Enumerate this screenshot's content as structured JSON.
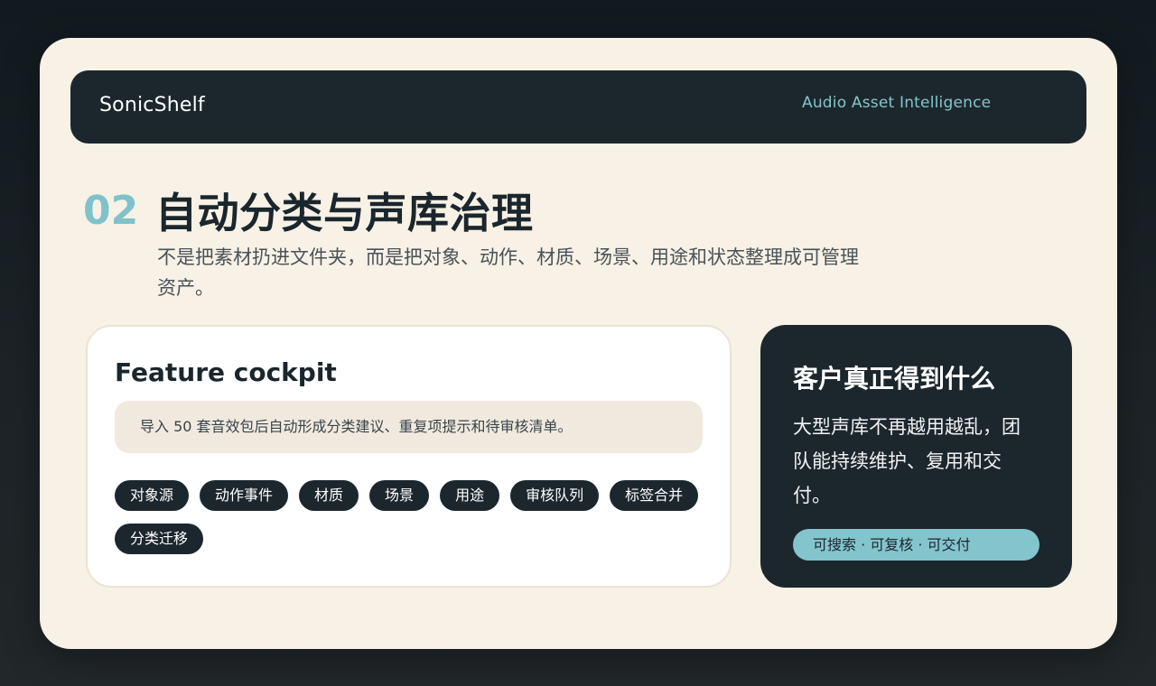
{
  "header": {
    "brand": "SonicShelf",
    "tagline": "Audio Asset Intelligence"
  },
  "section": {
    "number": "02",
    "title": "自动分类与声库治理",
    "description": "不是把素材扔进文件夹，而是把对象、动作、材质、场景、用途和状态整理成可管理资产。"
  },
  "feature": {
    "title": "Feature cockpit",
    "note": "导入 50 套音效包后自动形成分类建议、重复项提示和待审核清单。",
    "chips": [
      "对象源",
      "动作事件",
      "材质",
      "场景",
      "用途",
      "审核队列",
      "标签合并",
      "分类迁移"
    ]
  },
  "benefit": {
    "title": "客户真正得到什么",
    "body": "大型声库不再越用越乱，团队能持续维护、复用和交付。",
    "pill": "可搜索 · 可复核 · 可交付"
  },
  "colors": {
    "page_background": "#1a2125",
    "card_background": "#f7f1e6",
    "dark_panel": "#1c272d",
    "accent": "#84c5cd",
    "note_background": "#f0e9de"
  }
}
